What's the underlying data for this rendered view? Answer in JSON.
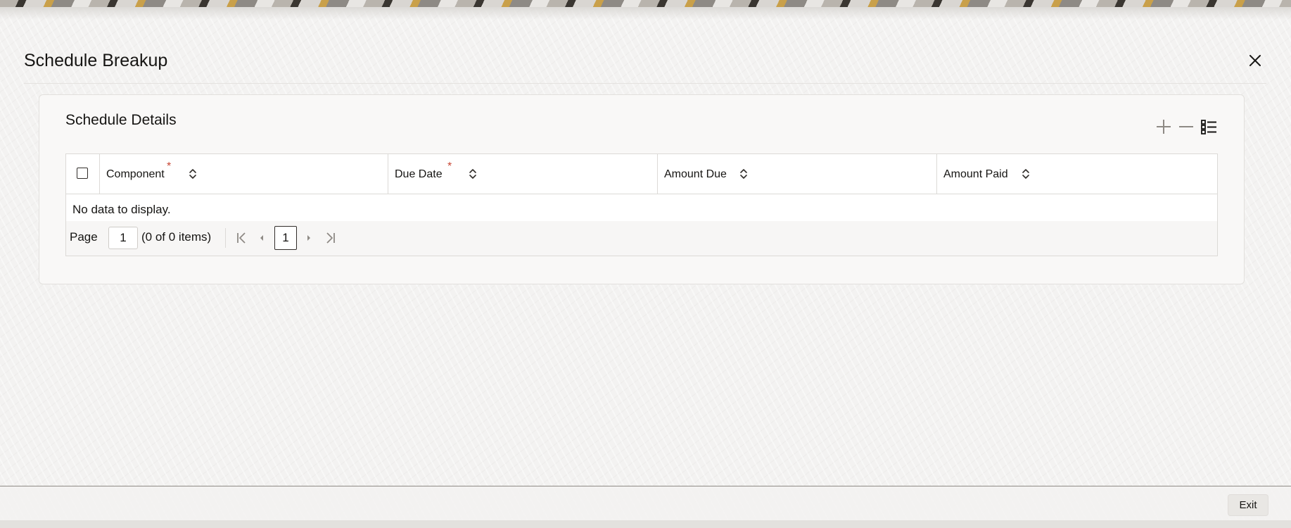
{
  "dialog": {
    "title": "Schedule Breakup",
    "close_icon": "close-icon"
  },
  "panel": {
    "title": "Schedule Details",
    "toolbar": {
      "add_icon": "plus-icon",
      "remove_icon": "minus-icon",
      "view_icon": "list-view-icon"
    }
  },
  "table": {
    "columns": [
      {
        "label": "Component",
        "required_mark": "*"
      },
      {
        "label": "Due Date",
        "required_mark": "*"
      },
      {
        "label": "Amount Due"
      },
      {
        "label": "Amount Paid"
      }
    ],
    "empty_message": "No data to display.",
    "rows": []
  },
  "pagination": {
    "page_label": "Page",
    "page_value": "1",
    "items_text": "(0 of 0 items)",
    "current_page": "1"
  },
  "footer": {
    "exit_label": "Exit"
  },
  "colors": {
    "required": "#c74634",
    "text": "#161513",
    "border": "#dcdad7"
  }
}
